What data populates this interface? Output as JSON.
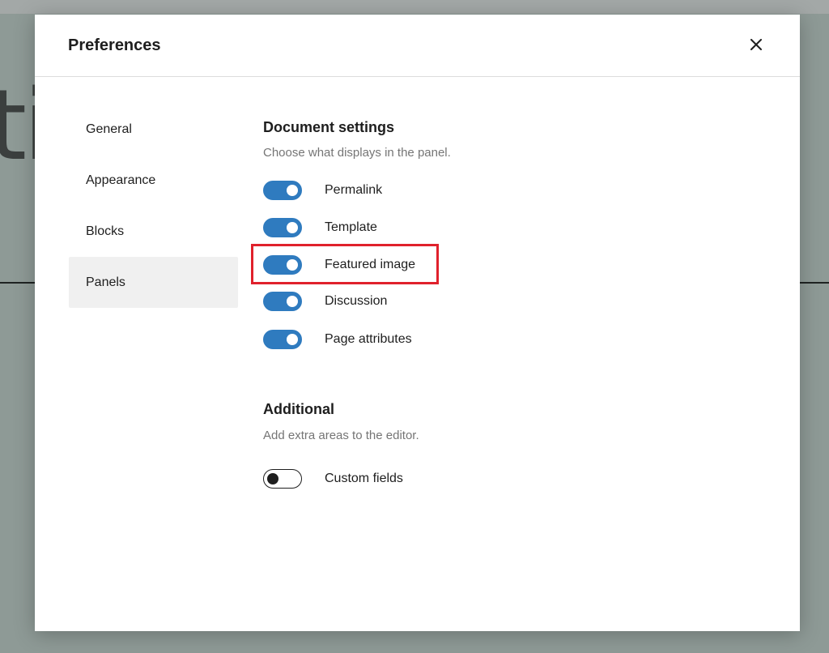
{
  "background": {
    "partial_text": "tit"
  },
  "modal": {
    "title": "Preferences",
    "close_label": "×"
  },
  "sidebar": {
    "items": [
      {
        "label": "General",
        "active": false
      },
      {
        "label": "Appearance",
        "active": false
      },
      {
        "label": "Blocks",
        "active": false
      },
      {
        "label": "Panels",
        "active": true
      }
    ]
  },
  "document_settings": {
    "title": "Document settings",
    "description": "Choose what displays in the panel.",
    "toggles": [
      {
        "label": "Permalink",
        "checked": true
      },
      {
        "label": "Template",
        "checked": true
      },
      {
        "label": "Featured image",
        "checked": true
      },
      {
        "label": "Discussion",
        "checked": true
      },
      {
        "label": "Page attributes",
        "checked": true
      }
    ]
  },
  "additional": {
    "title": "Additional",
    "description": "Add extra areas to the editor.",
    "toggles": [
      {
        "label": "Custom fields",
        "checked": false
      }
    ]
  },
  "colors": {
    "accent": "#2f7bbf",
    "highlight": "#e0212c"
  }
}
